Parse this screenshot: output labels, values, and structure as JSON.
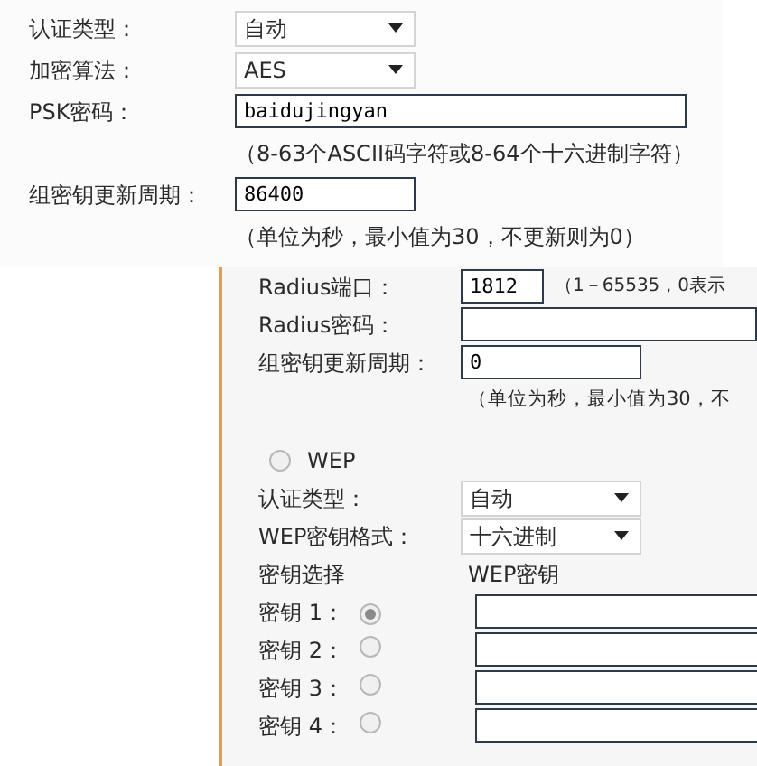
{
  "top_panel": {
    "rows": [
      {
        "kind": "select",
        "label": "认证类型：",
        "value": "自动"
      },
      {
        "kind": "select",
        "label": "加密算法：",
        "value": "AES"
      },
      {
        "kind": "longfield",
        "label": "PSK密码：",
        "value": "baidujingyan"
      },
      {
        "kind": "hint",
        "text": "（8-63个ASCII码字符或8-64个十六进制字符）"
      },
      {
        "kind": "field",
        "label": "组密钥更新周期：",
        "value": "86400"
      },
      {
        "kind": "hint",
        "text": "（单位为秒，最小值为30，不更新则为0）"
      }
    ]
  },
  "settings_page": {
    "rows": [
      {
        "kind": "shortfield",
        "label": "Radius端口：",
        "value": "1812",
        "note": "（1－65535，0表示"
      },
      {
        "kind": "longfield",
        "label": "Radius密码："
      },
      {
        "kind": "field",
        "label": "组密钥更新周期：",
        "value": "0"
      },
      {
        "kind": "hint",
        "text": "（单位为秒，最小值为30，不"
      },
      {
        "kind": "radio",
        "label": "WEP",
        "selected": false
      },
      {
        "kind": "select",
        "label": "认证类型：",
        "value": "自动"
      },
      {
        "kind": "select",
        "label": "WEP密钥格式：",
        "value": "十六进制"
      },
      {
        "kind": "header",
        "label": "密钥选择",
        "column": "WEP密钥"
      },
      {
        "kind": "key",
        "label": "密钥 1：",
        "selected": true
      },
      {
        "kind": "key",
        "label": "密钥 2：",
        "selected": false
      },
      {
        "kind": "key",
        "label": "密钥 3：",
        "selected": false
      },
      {
        "kind": "key",
        "label": "密钥 4：",
        "selected": false
      }
    ]
  }
}
